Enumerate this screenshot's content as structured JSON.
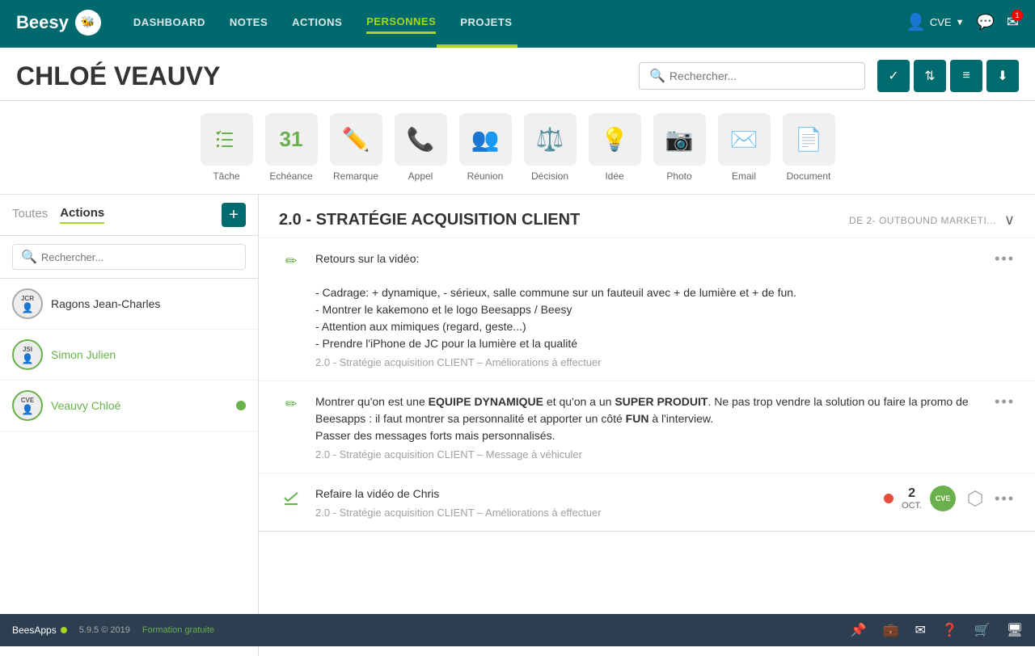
{
  "app": {
    "name": "Beesy",
    "logo": "🐝"
  },
  "nav": {
    "items": [
      {
        "id": "dashboard",
        "label": "DASHBOARD"
      },
      {
        "id": "notes",
        "label": "NOTES"
      },
      {
        "id": "actions",
        "label": "ACTIONS"
      },
      {
        "id": "personnes",
        "label": "PERSONNES",
        "active": true
      },
      {
        "id": "projets",
        "label": "PROJETS"
      }
    ],
    "user": "CVE",
    "notification_count": "1"
  },
  "header": {
    "title": "CHLOÉ VEAUVY",
    "search_placeholder": "Rechercher..."
  },
  "toolbar_icons": [
    {
      "id": "tache",
      "label": "Tâche",
      "symbol": "☑",
      "number": null
    },
    {
      "id": "echeance",
      "label": "Echéance",
      "symbol": "31",
      "number": "31"
    },
    {
      "id": "remarque",
      "label": "Remarque",
      "symbol": "✏",
      "number": null
    },
    {
      "id": "appel",
      "label": "Appel",
      "symbol": "📞",
      "number": null
    },
    {
      "id": "reunion",
      "label": "Réunion",
      "symbol": "👥",
      "number": null
    },
    {
      "id": "decision",
      "label": "Décision",
      "symbol": "⚖",
      "number": null
    },
    {
      "id": "idee",
      "label": "Idée",
      "symbol": "💡",
      "number": null
    },
    {
      "id": "photo",
      "label": "Photo",
      "symbol": "📷",
      "number": null
    },
    {
      "id": "email",
      "label": "Email",
      "symbol": "✉",
      "number": null
    },
    {
      "id": "document",
      "label": "Document",
      "symbol": "📄",
      "number": null
    }
  ],
  "sidebar": {
    "tab_toutes": "Toutes",
    "tab_actions": "Actions",
    "search_placeholder": "Rechercher...",
    "add_tooltip": "+",
    "persons": [
      {
        "id": "jcr",
        "initials": "JCR",
        "name": "Ragons Jean-Charles",
        "online": false
      },
      {
        "id": "jsi",
        "initials": "JSI",
        "name": "Simon Julien",
        "online": false,
        "green": true
      },
      {
        "id": "cve",
        "initials": "CVE",
        "name": "Veauvy Chloé",
        "online": true,
        "green": true
      }
    ]
  },
  "content": {
    "project": {
      "title": "2.0 - STRATÉGIE ACQUISITION CLIENT",
      "subtitle": "DE 2- OUTBOUND MARKETI..."
    },
    "actions": [
      {
        "id": "action1",
        "type": "edit",
        "text": "Retours sur la vidéo:\n\n- Cadrage: + dynamique, - sérieux, salle commune sur un fauteuil avec + de lumière et + de fun.\n- Montrer le kakemono et le logo Beesapps / Beesy\n- Attention aux mimiques (regard, geste...)\n- Prendre l'iPhone de JC pour la lumière et la qualité",
        "subtext": "2.0 - Stratégie acquisition CLIENT – Améliorations à effectuer",
        "has_meta": false
      },
      {
        "id": "action2",
        "type": "edit",
        "text": "Montrer qu'on est une EQUIPE DYNAMIQUE et qu'on a un SUPER PRODUIT. Ne pas trop vendre la solution ou faire la promo de Beesapps : il faut montrer sa personnalité et apporter un côté FUN à l'interview.\nPasser des messages forts mais personnalisés.",
        "subtext": "2.0 - Stratégie acquisition CLIENT – Message à véhiculer",
        "has_meta": false
      },
      {
        "id": "action3",
        "type": "task",
        "text": "Refaire la vidéo de Chris",
        "subtext": "2.0 - Stratégie acquisition CLIENT – Améliorations à effectuer",
        "has_meta": true,
        "date_num": "2",
        "date_label": "OCT.",
        "assignee": "CVE"
      }
    ]
  },
  "bottom_bar": {
    "brand": "BeesApps",
    "version": "5.9.5 © 2019",
    "link": "Formation gratuite"
  }
}
